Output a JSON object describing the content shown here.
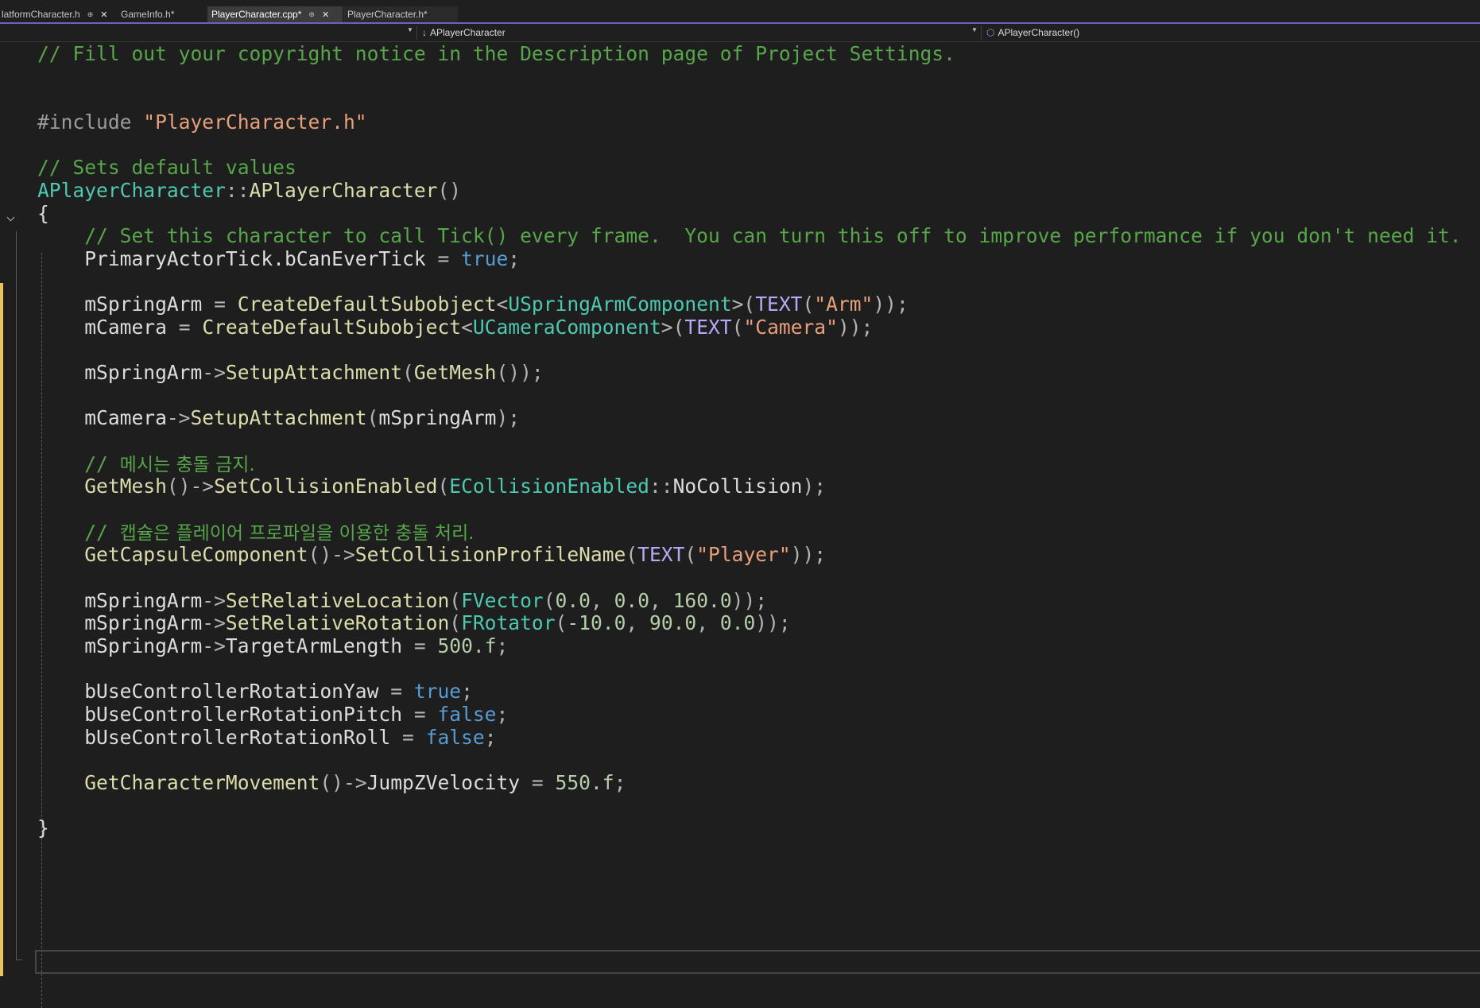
{
  "tabs": [
    {
      "label": "latformCharacter.h",
      "pin": "⊕",
      "close": "✕",
      "active": false
    },
    {
      "label": "GameInfo.h*",
      "active": false
    },
    {
      "label": "PlayerCharacter.cpp*",
      "pin": "⊕",
      "close": "✕",
      "active": true
    },
    {
      "label": "PlayerCharacter.h*",
      "active": false
    }
  ],
  "navbar": {
    "class_selector": "APlayerCharacter",
    "member_selector": "APlayerCharacter()"
  },
  "colors": {
    "comment": "#57a64a",
    "preprocessor": "#9b9b9b",
    "string": "#e8a07c",
    "type": "#4ec9b0",
    "function": "#dcdcaa",
    "keyword": "#569cd6",
    "macro": "#b8a8f5",
    "number": "#b5cea8",
    "identifier": "#dcdcdc"
  },
  "code": [
    [
      [
        "c",
        "// Fill out your copyright notice in the Description page of Project Settings."
      ]
    ],
    [],
    [],
    [
      [
        "p",
        "#include "
      ],
      [
        "s",
        "\"PlayerCharacter.h\""
      ]
    ],
    [],
    [
      [
        "c",
        "// Sets default values"
      ]
    ],
    [
      [
        "t",
        "APlayerCharacter"
      ],
      [
        "o",
        "::"
      ],
      [
        "f",
        "APlayerCharacter"
      ],
      [
        "o",
        "()"
      ]
    ],
    [
      [
        "v",
        "{"
      ]
    ],
    [
      [
        "v",
        "    "
      ],
      [
        "c",
        "// Set this character to call Tick() every frame.  You can turn this off to improve performance if you don't need it."
      ]
    ],
    [
      [
        "v",
        "    PrimaryActorTick.bCanEverTick "
      ],
      [
        "o",
        "= "
      ],
      [
        "k",
        "true"
      ],
      [
        "o",
        ";"
      ]
    ],
    [],
    [
      [
        "v",
        "    mSpringArm "
      ],
      [
        "o",
        "= "
      ],
      [
        "f",
        "CreateDefaultSubobject"
      ],
      [
        "o",
        "<"
      ],
      [
        "t",
        "USpringArmComponent"
      ],
      [
        "o",
        ">("
      ],
      [
        "m",
        "TEXT"
      ],
      [
        "o",
        "("
      ],
      [
        "s",
        "\"Arm\""
      ],
      [
        "o",
        "));"
      ]
    ],
    [
      [
        "v",
        "    mCamera "
      ],
      [
        "o",
        "= "
      ],
      [
        "f",
        "CreateDefaultSubobject"
      ],
      [
        "o",
        "<"
      ],
      [
        "t",
        "UCameraComponent"
      ],
      [
        "o",
        ">("
      ],
      [
        "m",
        "TEXT"
      ],
      [
        "o",
        "("
      ],
      [
        "s",
        "\"Camera\""
      ],
      [
        "o",
        "));"
      ]
    ],
    [],
    [
      [
        "v",
        "    mSpringArm"
      ],
      [
        "o",
        "->"
      ],
      [
        "f",
        "SetupAttachment"
      ],
      [
        "o",
        "("
      ],
      [
        "f",
        "GetMesh"
      ],
      [
        "o",
        "());"
      ]
    ],
    [],
    [
      [
        "v",
        "    mCamera"
      ],
      [
        "o",
        "->"
      ],
      [
        "f",
        "SetupAttachment"
      ],
      [
        "o",
        "("
      ],
      [
        "v",
        "mSpringArm"
      ],
      [
        "o",
        ");"
      ]
    ],
    [],
    [
      [
        "v",
        "    "
      ],
      [
        "c",
        "// "
      ],
      [
        "ck",
        "메시는 충돌 금지."
      ]
    ],
    [
      [
        "v",
        "    "
      ],
      [
        "f",
        "GetMesh"
      ],
      [
        "o",
        "()->"
      ],
      [
        "f",
        "SetCollisionEnabled"
      ],
      [
        "o",
        "("
      ],
      [
        "t",
        "ECollisionEnabled"
      ],
      [
        "o",
        "::"
      ],
      [
        "v",
        "NoCollision"
      ],
      [
        "o",
        ");"
      ]
    ],
    [],
    [
      [
        "v",
        "    "
      ],
      [
        "c",
        "// "
      ],
      [
        "ck",
        "캡슐은 플레이어 프로파일을 이용한 충돌 처리."
      ]
    ],
    [
      [
        "v",
        "    "
      ],
      [
        "f",
        "GetCapsuleComponent"
      ],
      [
        "o",
        "()->"
      ],
      [
        "f",
        "SetCollisionProfileName"
      ],
      [
        "o",
        "("
      ],
      [
        "m",
        "TEXT"
      ],
      [
        "o",
        "("
      ],
      [
        "s",
        "\"Player\""
      ],
      [
        "o",
        "));"
      ]
    ],
    [],
    [
      [
        "v",
        "    mSpringArm"
      ],
      [
        "o",
        "->"
      ],
      [
        "f",
        "SetRelativeLocation"
      ],
      [
        "o",
        "("
      ],
      [
        "t",
        "FVector"
      ],
      [
        "o",
        "("
      ],
      [
        "n",
        "0.0"
      ],
      [
        "o",
        ", "
      ],
      [
        "n",
        "0.0"
      ],
      [
        "o",
        ", "
      ],
      [
        "n",
        "160.0"
      ],
      [
        "o",
        "));"
      ]
    ],
    [
      [
        "v",
        "    mSpringArm"
      ],
      [
        "o",
        "->"
      ],
      [
        "f",
        "SetRelativeRotation"
      ],
      [
        "o",
        "("
      ],
      [
        "t",
        "FRotator"
      ],
      [
        "o",
        "("
      ],
      [
        "n",
        "-10.0"
      ],
      [
        "o",
        ", "
      ],
      [
        "n",
        "90.0"
      ],
      [
        "o",
        ", "
      ],
      [
        "n",
        "0.0"
      ],
      [
        "o",
        "));"
      ]
    ],
    [
      [
        "v",
        "    mSpringArm"
      ],
      [
        "o",
        "->"
      ],
      [
        "v",
        "TargetArmLength "
      ],
      [
        "o",
        "= "
      ],
      [
        "n",
        "500.f"
      ],
      [
        "o",
        ";"
      ]
    ],
    [],
    [
      [
        "v",
        "    bUseControllerRotationYaw "
      ],
      [
        "o",
        "= "
      ],
      [
        "k",
        "true"
      ],
      [
        "o",
        ";"
      ]
    ],
    [
      [
        "v",
        "    bUseControllerRotationPitch "
      ],
      [
        "o",
        "= "
      ],
      [
        "k",
        "false"
      ],
      [
        "o",
        ";"
      ]
    ],
    [
      [
        "v",
        "    bUseControllerRotationRoll "
      ],
      [
        "o",
        "= "
      ],
      [
        "k",
        "false"
      ],
      [
        "o",
        ";"
      ]
    ],
    [],
    [
      [
        "v",
        "    "
      ],
      [
        "f",
        "GetCharacterMovement"
      ],
      [
        "o",
        "()->"
      ],
      [
        "v",
        "JumpZVelocity "
      ],
      [
        "o",
        "= "
      ],
      [
        "n",
        "550.f"
      ],
      [
        "o",
        ";"
      ]
    ],
    [],
    [
      [
        "v",
        "}"
      ]
    ]
  ]
}
